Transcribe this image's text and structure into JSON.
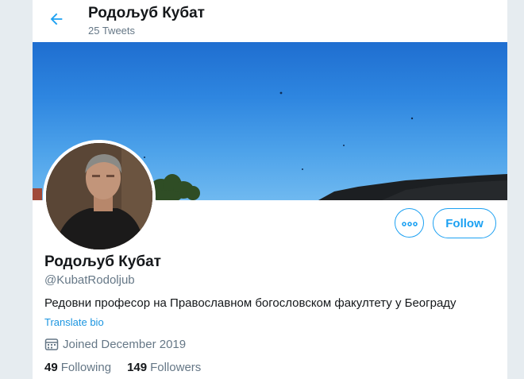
{
  "header": {
    "name": "Родољуб Кубат",
    "tweet_count": "25 Tweets"
  },
  "profile": {
    "name": "Родољуб Кубат",
    "handle": "@KubatRodoljub",
    "bio": "Редовни професор на Православном богословском факултету у Београду",
    "translate_label": "Translate bio",
    "joined": "Joined December 2019"
  },
  "actions": {
    "follow_label": "Follow"
  },
  "stats": {
    "following_count": "49",
    "following_label": "Following",
    "followers_count": "149",
    "followers_label": "Followers"
  },
  "colors": {
    "accent": "#1da1f2",
    "secondary_text": "#657786",
    "primary_text": "#14171a"
  },
  "icons": {
    "back": "arrow-left-icon",
    "more": "more-horizontal-icon",
    "joined": "calendar-icon"
  }
}
